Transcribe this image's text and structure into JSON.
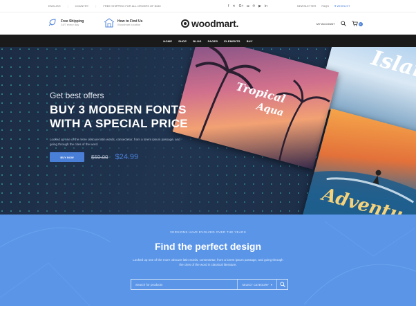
{
  "topbar": {
    "language": "ENGLISH",
    "country": "COUNTRY",
    "promo": "FREE SHIPPING FOR ALL ORDERS OF $150",
    "social_icons": [
      "facebook-icon",
      "twitter-icon",
      "google-plus-icon",
      "instagram-icon",
      "pinterest-icon",
      "youtube-icon",
      "linkedin-icon"
    ],
    "newsletter": "NEWSLETTER",
    "faq": "FAQS",
    "wishlist": "WISHLIST"
  },
  "header": {
    "feature1_title": "Free Shipping",
    "feature1_sub": "24/7 every day",
    "feature2_title": "How to Find Us",
    "feature2_sub": "Woodmart location",
    "logo": "woodmart.",
    "my_account": "MY ACCOUNT",
    "cart_count": "0"
  },
  "nav": {
    "items": [
      "HOME",
      "SHOP",
      "BLOG",
      "PAGES",
      "ELEMENTS",
      "BUY"
    ]
  },
  "hero": {
    "eyebrow": "Get best offers",
    "title_line1": "BUY 3 MODERN FONTS",
    "title_line2": "WITH A SPECIAL PRICE",
    "description": "Looked up one of the more obscure latin words, consectetur, from a lorem ipsum passage, and going through the cites of the word.",
    "button": "BUY NOW",
    "old_price": "$59.00",
    "new_price": "$24.99",
    "card1_script1": "Tropical",
    "card1_script2": "Aqua",
    "card2_script": "Islan",
    "card3_script": "Adventu"
  },
  "finder": {
    "eyebrow": "VERSIONS HAVE EVOLVED OVER THE YEARS",
    "title": "Find the perfect design",
    "description": "Looked up one of the more obscure latin words, consectetur, from a lorem ipsum passage, and going through the cites of the word in classical literature.",
    "search_placeholder": "Search for products",
    "category_label": "SELECT CATEGORY"
  },
  "colors": {
    "accent": "#4a7fd8",
    "hero_bg": "#1f3049",
    "finder_bg": "#5a95e8",
    "nav_bg": "#1a1a1a"
  }
}
